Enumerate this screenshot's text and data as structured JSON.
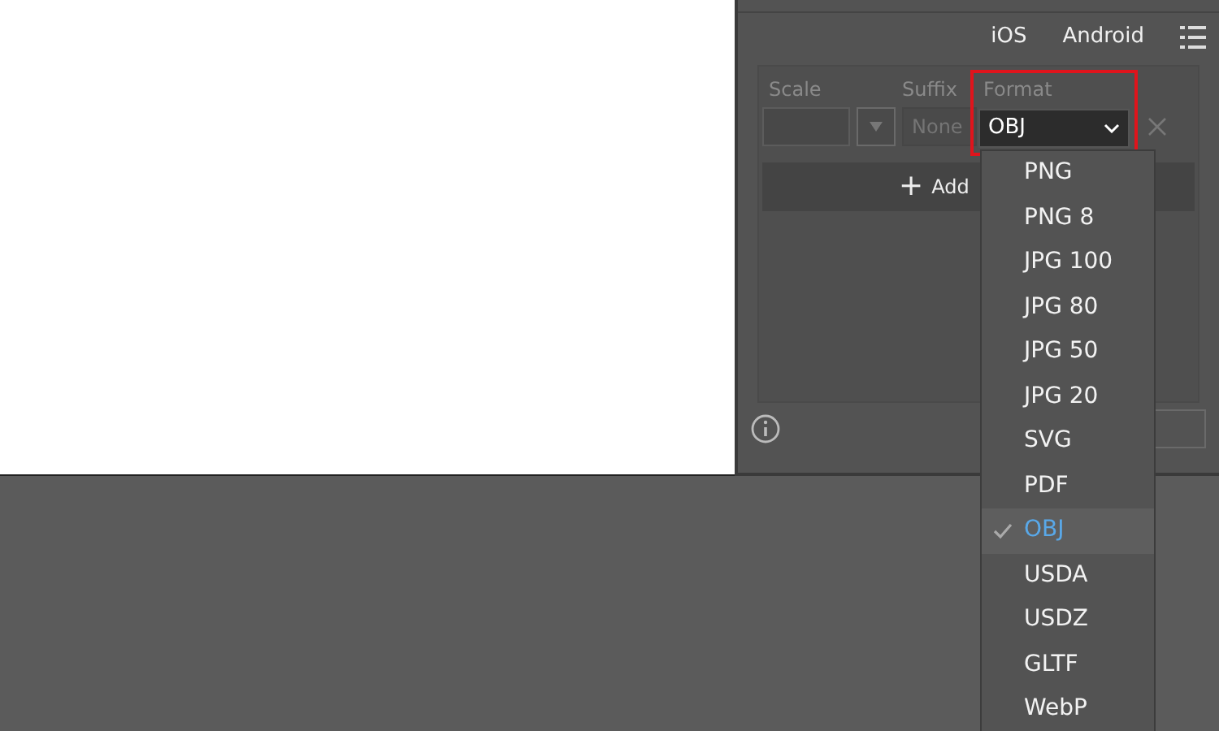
{
  "platform_tabs": [
    {
      "label": "iOS"
    },
    {
      "label": "Android"
    }
  ],
  "export_row": {
    "scale_label": "Scale",
    "suffix_label": "Suffix",
    "format_label": "Format",
    "suffix_placeholder": "None",
    "format_value": "OBJ",
    "highlighted": true
  },
  "add_button": {
    "icon": "+",
    "label": "Add"
  },
  "format_menu": [
    {
      "label": "PNG",
      "selected": false
    },
    {
      "label": "PNG 8",
      "selected": false
    },
    {
      "label": "JPG 100",
      "selected": false
    },
    {
      "label": "JPG 80",
      "selected": false
    },
    {
      "label": "JPG 50",
      "selected": false
    },
    {
      "label": "JPG 20",
      "selected": false
    },
    {
      "label": "SVG",
      "selected": false
    },
    {
      "label": "PDF",
      "selected": false
    },
    {
      "label": "OBJ",
      "selected": true
    },
    {
      "label": "USDA",
      "selected": false
    },
    {
      "label": "USDZ",
      "selected": false
    },
    {
      "label": "GLTF",
      "selected": false
    },
    {
      "label": "WebP",
      "selected": false
    }
  ]
}
